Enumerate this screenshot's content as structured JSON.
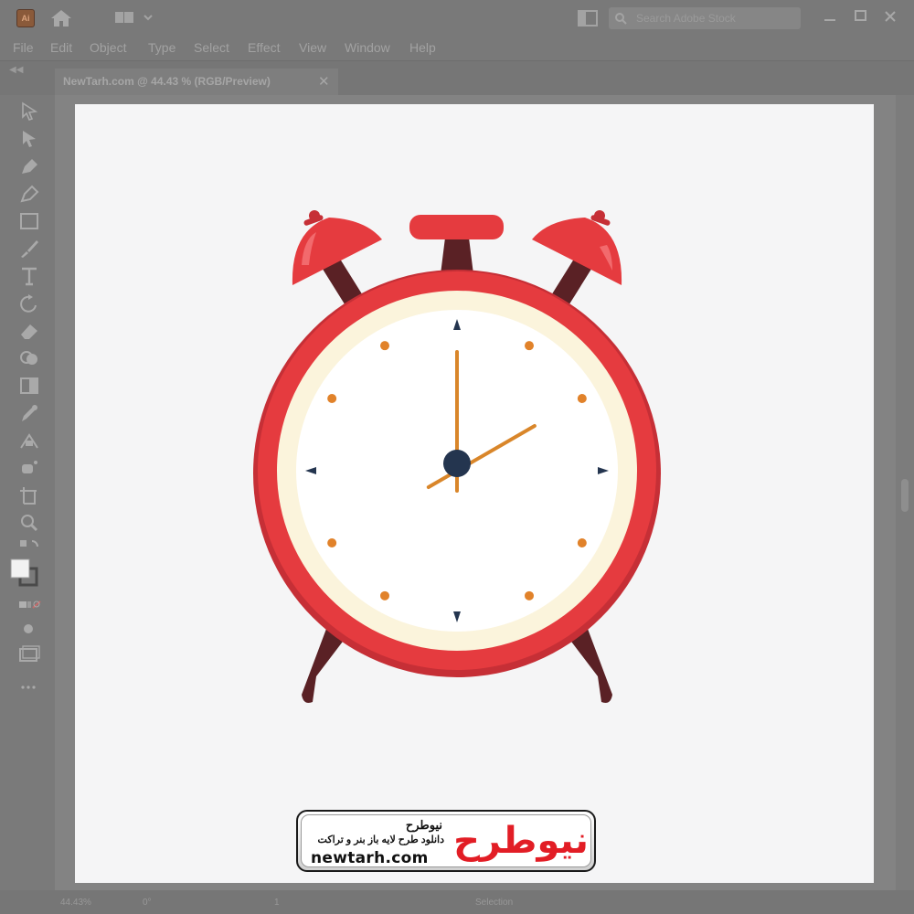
{
  "app": {
    "logo_text": "Ai",
    "search_placeholder": "Search Adobe Stock"
  },
  "menu": {
    "items": [
      "File",
      "Edit",
      "Object",
      "Type",
      "Select",
      "Effect",
      "View",
      "Window",
      "Help"
    ]
  },
  "document_tab": {
    "title": "NewTarh.com @ 44.43 % (RGB/Preview)",
    "close_glyph": "✕"
  },
  "status": {
    "zoom": "44.43%",
    "rotation": "0°",
    "artboard": "1",
    "tool": "Selection"
  },
  "clock": {
    "hour_hand_points_to": 2,
    "minute_hand_points_to": 0,
    "colors": {
      "body": "#e53b3f",
      "body_dark": "#c62f36",
      "legs": "#5a2125",
      "face_rim": "#fbf4dc",
      "face": "#ffffff",
      "hands": "#d9862a",
      "center": "#24354f",
      "hour_dots": "#e1822a",
      "quarter_marks": "#24354f"
    }
  },
  "watermark": {
    "title": "نیوطرح",
    "subtitle": "دانلود طرح لایه باز بنر و تراکت",
    "url": "newtarh.com",
    "brand": "نیوطرح",
    "brand_color": "#e21d25"
  }
}
